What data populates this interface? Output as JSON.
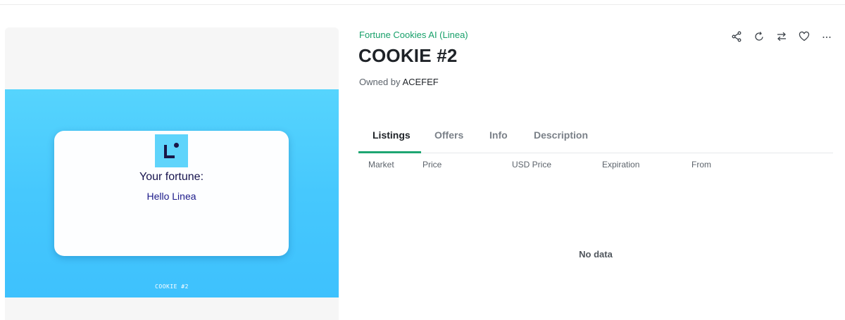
{
  "artwork": {
    "fortune_heading": "Your fortune:",
    "fortune_text": "Hello Linea",
    "caption": "COOKIE #2",
    "logo_icon": "linea-logo",
    "background_color": "#4ccdfd"
  },
  "details": {
    "collection": "Fortune Cookies AI (Linea)",
    "title": "COOKIE #2",
    "owned_by_label": "Owned by",
    "owner": "ACEFEF",
    "accent_color": "#17a06a"
  },
  "actions": [
    {
      "name": "share",
      "icon": "share-icon"
    },
    {
      "name": "refresh",
      "icon": "refresh-icon"
    },
    {
      "name": "transfer",
      "icon": "transfer-icon"
    },
    {
      "name": "favorite",
      "icon": "heart-icon"
    },
    {
      "name": "more",
      "icon": "more-icon"
    }
  ],
  "tabs": {
    "items": [
      "Listings",
      "Offers",
      "Info",
      "Description"
    ],
    "active": "Listings"
  },
  "listings_table": {
    "columns": [
      "Market",
      "Price",
      "USD Price",
      "Expiration",
      "From"
    ],
    "rows": [],
    "empty_text": "No data"
  }
}
